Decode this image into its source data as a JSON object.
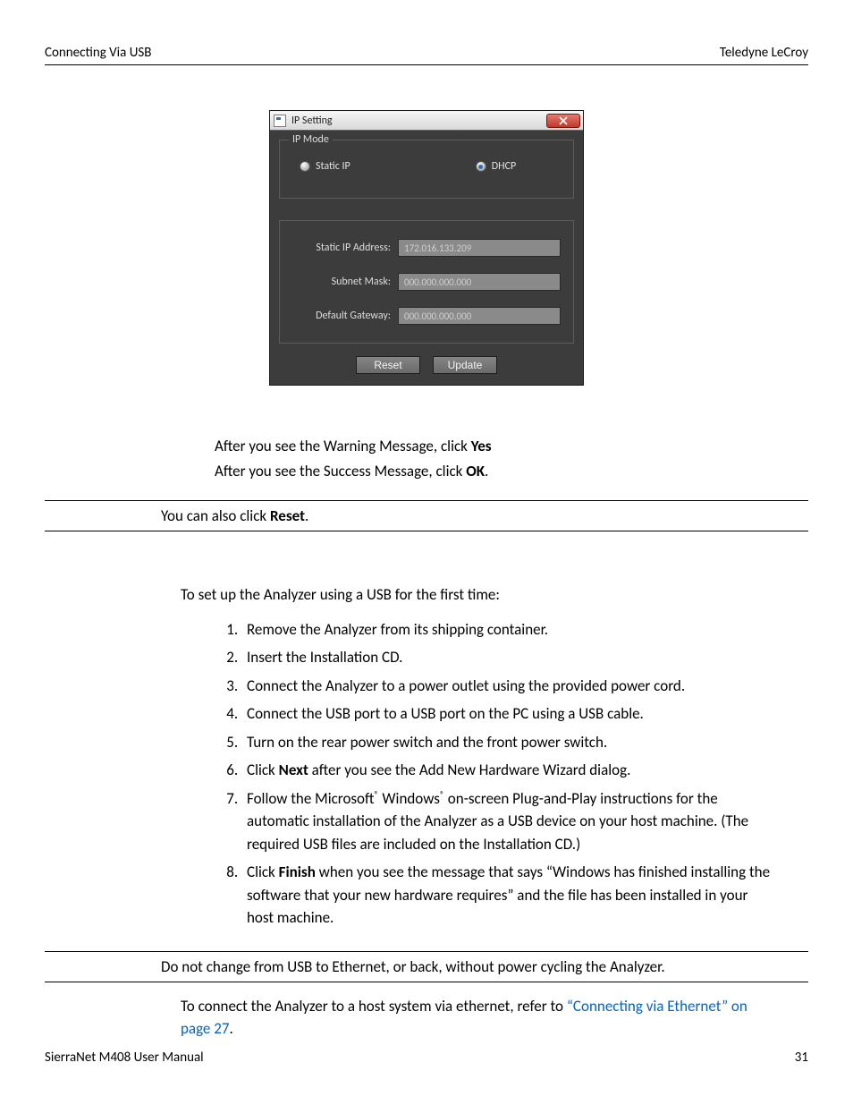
{
  "header": {
    "left": "Connecting Via USB",
    "right": "Teledyne LeCroy"
  },
  "dialog": {
    "title": "IP Setting",
    "mode_legend": "IP Mode",
    "radio_static": "Static IP",
    "radio_dhcp": "DHCP",
    "selected_mode": "dhcp",
    "static_ip_label": "Static IP Address:",
    "static_ip_value": "172.016.133.209",
    "subnet_label": "Subnet Mask:",
    "subnet_value": "000.000.000.000",
    "gateway_label": "Default Gateway:",
    "gateway_value": "000.000.000.000",
    "reset_label": "Reset",
    "update_label": "Update"
  },
  "body": {
    "line1a": "After you see the Warning Message, click ",
    "line1b": "Yes",
    "line2a": "After you see the Success Message, click ",
    "line2b": "OK",
    "line2c": ".",
    "note1a": "You can also click ",
    "note1b": "Reset",
    "note1c": ".",
    "intro": "To set up the Analyzer using a USB for the first time:",
    "steps": [
      "Remove the Analyzer from its shipping container.",
      "Insert the Installation CD.",
      "Connect the Analyzer to a power outlet using the provided power cord.",
      "Connect the USB port to a USB port on the PC using a USB cable.",
      "Turn on the rear power switch and the front power switch."
    ],
    "step6a": "Click ",
    "step6b": "Next",
    "step6c": " after you see the Add New Hardware Wizard dialog.",
    "step7a": "Follow the Microsoft",
    "step7b": " Windows",
    "step7c": " on-screen Plug-and-Play instructions for the automatic installation of the Analyzer as a USB device on your host machine. (The required USB files are included on the Installation CD.)",
    "step8a": "Click ",
    "step8b": "Finish",
    "step8c": " when you see the message that says “Windows has finished installing the software that your new hardware requires” and the file has been installed in your host machine.",
    "note2": "Do not change from USB to Ethernet, or back, without power cycling the Analyzer.",
    "aftera": "To connect the Analyzer to a host system via ethernet, refer to ",
    "link": "“Connecting via Ethernet” on page 27",
    "afterb": "."
  },
  "footer": {
    "left": "SierraNet M408 User Manual",
    "right": "31"
  }
}
